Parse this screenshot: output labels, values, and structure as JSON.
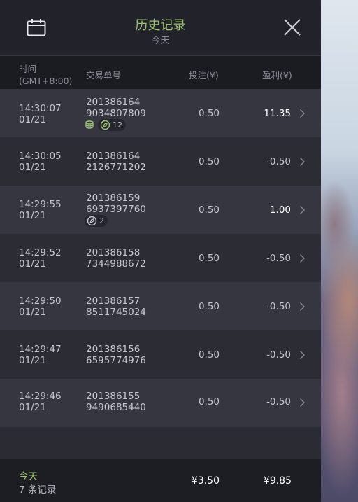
{
  "header": {
    "title": "历史记录",
    "subtitle": "今天",
    "calendar_icon": "calendar-icon",
    "close_icon": "close-icon"
  },
  "columns": {
    "time_line1": "时间",
    "time_line2": "(GMT+8:00)",
    "order": "交易单号",
    "bet": "投注(¥)",
    "profit": "盈利(¥)"
  },
  "rows": [
    {
      "time": "14:30:07",
      "date": "01/21",
      "order1": "201386164",
      "order2": "9034807809",
      "bet": "0.50",
      "profit": "11.35",
      "badge": "12",
      "badge_icons": [
        "coins-icon",
        "compass-icon"
      ]
    },
    {
      "time": "14:30:05",
      "date": "01/21",
      "order1": "201386164",
      "order2": "2126771202",
      "bet": "0.50",
      "profit": "-0.50"
    },
    {
      "time": "14:29:55",
      "date": "01/21",
      "order1": "201386159",
      "order2": "6937397760",
      "bet": "0.50",
      "profit": "1.00",
      "badge": "2",
      "badge_icons": [
        "compass-icon"
      ]
    },
    {
      "time": "14:29:52",
      "date": "01/21",
      "order1": "201386158",
      "order2": "7344988672",
      "bet": "0.50",
      "profit": "-0.50"
    },
    {
      "time": "14:29:50",
      "date": "01/21",
      "order1": "201386157",
      "order2": "8511745024",
      "bet": "0.50",
      "profit": "-0.50"
    },
    {
      "time": "14:29:47",
      "date": "01/21",
      "order1": "201386156",
      "order2": "6595774976",
      "bet": "0.50",
      "profit": "-0.50"
    },
    {
      "time": "14:29:46",
      "date": "01/21",
      "order1": "201386155",
      "order2": "9490685440",
      "bet": "0.50",
      "profit": "-0.50"
    }
  ],
  "footer": {
    "today": "今天",
    "count": "7 条记录",
    "total_bet": "¥3.50",
    "total_profit": "¥9.85"
  },
  "colors": {
    "accent_green": "#9bc36c",
    "panel_bg": "#1f1f27",
    "row_odd": "#363640",
    "row_even": "#2c2c35"
  }
}
